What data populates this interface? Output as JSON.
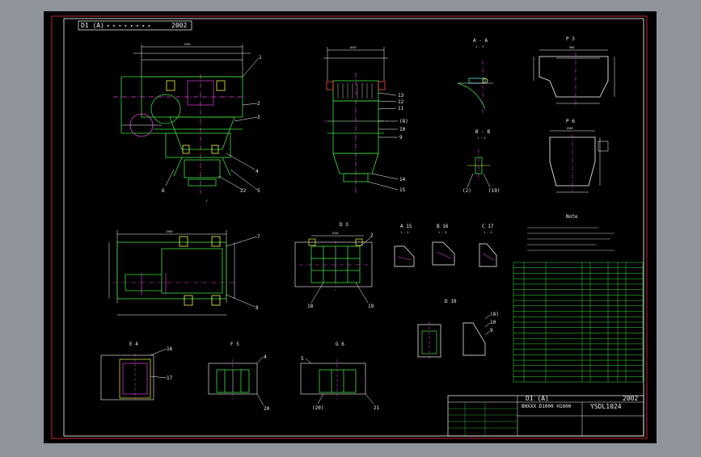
{
  "colors": {
    "background": "#8f949b",
    "paper": "#000000",
    "frame_outer": "#c0262c",
    "frame_inner": "#ffffff",
    "structure": "#3ee03e",
    "dimension": "#ffffff",
    "centerline": "#e040e0",
    "highlight": "#f5f542",
    "accent": "#ff5050",
    "cyan": "#3ee8e8"
  },
  "title_bar": {
    "left_label": "D1 (A)",
    "year": "2002"
  },
  "title_block": {
    "label": "D1 (A)",
    "model": "BHXXX   D1000   H1600",
    "drawing_no": "YSDL1024",
    "year": "2002"
  },
  "views": {
    "section_aa": "A - A",
    "section_bb": "B - B",
    "scale": "1 : 5",
    "view_p": "P 3",
    "view_q": "P 6",
    "view_c": "C",
    "view_d": "D 3",
    "view_e": "E 4",
    "view_f": "F 5",
    "view_g": "G 6",
    "detail_a": "A 15",
    "detail_b": "B 16",
    "detail_c": "C 17",
    "detail_d": "D 10",
    "notes_title": "Note"
  },
  "balloons": {
    "front": [
      "1",
      "2",
      "3",
      "4",
      "5",
      "6",
      "22"
    ],
    "side": [
      "13",
      "12",
      "11",
      "(8)",
      "10",
      "9",
      "14",
      "15"
    ],
    "plan": [
      "7",
      "8"
    ],
    "d3": [
      "2",
      "18",
      "19"
    ],
    "e4": [
      "16",
      "17"
    ],
    "f5": [
      "4",
      "20"
    ],
    "g6": [
      "5",
      "(20)",
      "21"
    ],
    "bb": [
      "(2)",
      "(19)"
    ],
    "d10": [
      "(8)",
      "10",
      "9"
    ]
  },
  "dimension_samples": {
    "top_width": "1200",
    "side_width": "1050",
    "plan_width": "1500",
    "d3_width": "1250",
    "p3_width": "900",
    "p6_width": "1200"
  }
}
